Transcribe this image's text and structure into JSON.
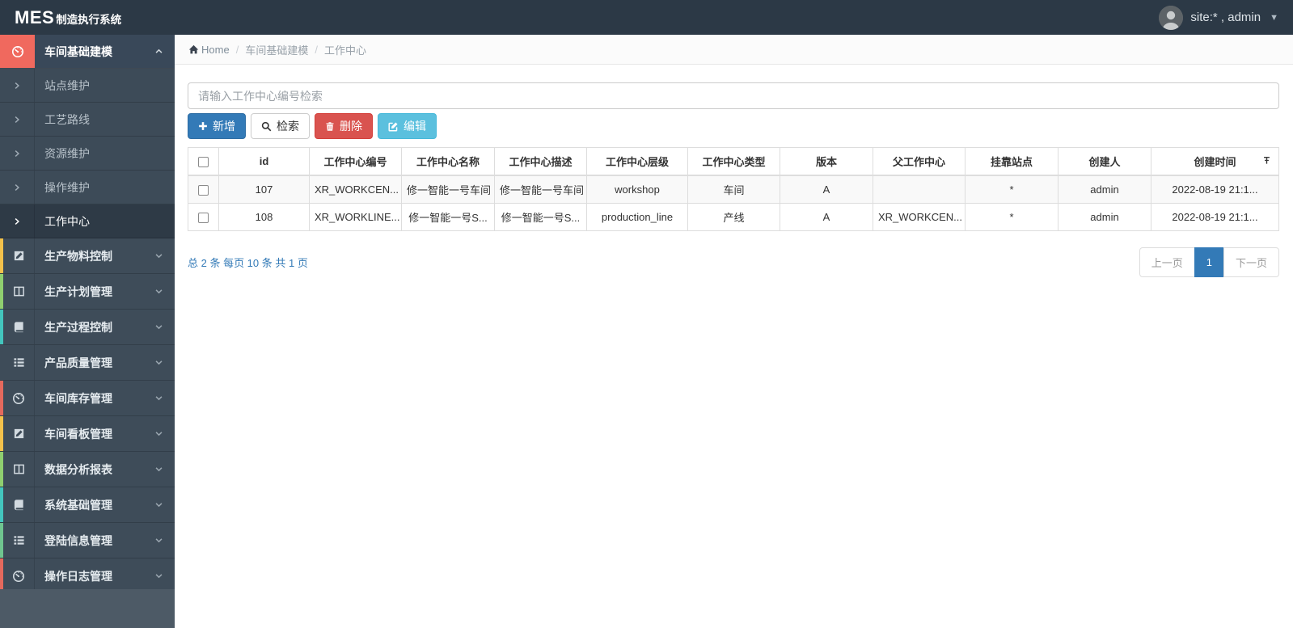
{
  "topbar": {
    "brand_mes": "MES",
    "brand_rest": "制造执行系统",
    "user_label": "site:* , admin"
  },
  "breadcrumb": {
    "home": "Home",
    "items": [
      "车间基础建模",
      "工作中心"
    ]
  },
  "sidebar": {
    "group": {
      "label": "车间基础建模",
      "icon": "dashboard-icon",
      "accent_color": "#f0695e",
      "children": [
        {
          "label": "站点维护",
          "active": false
        },
        {
          "label": "工艺路线",
          "active": false
        },
        {
          "label": "资源维护",
          "active": false
        },
        {
          "label": "操作维护",
          "active": false
        },
        {
          "label": "工作中心",
          "active": true
        }
      ]
    },
    "items": [
      {
        "label": "生产物料控制",
        "icon": "pencil-square-icon",
        "strip": "#f3c14b"
      },
      {
        "label": "生产计划管理",
        "icon": "columns-icon",
        "strip": "#8fcf6f"
      },
      {
        "label": "生产过程控制",
        "icon": "book-icon",
        "strip": "#43c5bd"
      },
      {
        "label": "产品质量管理",
        "icon": "list-icon",
        "strip": ""
      },
      {
        "label": "车间库存管理",
        "icon": "dashboard-icon",
        "strip": "#e4695d"
      },
      {
        "label": "车间看板管理",
        "icon": "pencil-square-icon",
        "strip": "#f3c14b"
      },
      {
        "label": "数据分析报表",
        "icon": "columns-icon",
        "strip": "#8fcf6f"
      },
      {
        "label": "系统基础管理",
        "icon": "book-icon",
        "strip": "#43c5bd"
      },
      {
        "label": "登陆信息管理",
        "icon": "list-icon",
        "strip": "#6fc58f"
      },
      {
        "label": "操作日志管理",
        "icon": "dashboard-icon",
        "strip": "#e4695d"
      }
    ]
  },
  "search": {
    "placeholder": "请输入工作中心编号检索",
    "value": ""
  },
  "toolbar": {
    "add_label": "新增",
    "search_label": "检索",
    "delete_label": "删除",
    "edit_label": "编辑"
  },
  "table": {
    "columns": [
      "id",
      "工作中心编号",
      "工作中心名称",
      "工作中心描述",
      "工作中心层级",
      "工作中心类型",
      "版本",
      "父工作中心",
      "挂靠站点",
      "创建人",
      "创建时间"
    ],
    "rows": [
      [
        "107",
        "XR_WORKCEN...",
        "修一智能一号车间",
        "修一智能一号车间",
        "workshop",
        "车间",
        "A",
        "",
        "*",
        "admin",
        "2022-08-19 21:1..."
      ],
      [
        "108",
        "XR_WORKLINE...",
        "修一智能一号S...",
        "修一智能一号S...",
        "production_line",
        "产线",
        "A",
        "XR_WORKCEN...",
        "*",
        "admin",
        "2022-08-19 21:1..."
      ]
    ]
  },
  "pagination": {
    "summary": "总 2 条  每页 10 条  共 1 页",
    "prev_label": "上一页",
    "page_label": "1",
    "next_label": "下一页"
  },
  "colors": {
    "topbar_bg": "#2c3946",
    "sidebar_bg": "#4d5a66",
    "menu_row_bg": "#3e4c59",
    "active_item_bg": "#2e3a46",
    "accent_red": "#f0695e",
    "primary": "#337ab7",
    "danger": "#d9534f",
    "info": "#5bc0de"
  }
}
